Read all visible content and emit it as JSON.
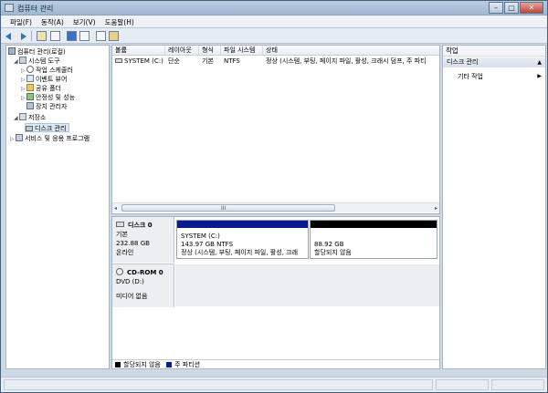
{
  "window": {
    "title": "컴퓨터 관리"
  },
  "window_buttons": {
    "minimize": "–",
    "maximize": "□",
    "close": "✕"
  },
  "menu": [
    "파일(F)",
    "동작(A)",
    "보기(V)",
    "도움말(H)"
  ],
  "tree": [
    {
      "label": "컴퓨터 관리(로컬)",
      "icon": "computer-icon",
      "indent": 0,
      "twisty": ""
    },
    {
      "label": "시스템 도구",
      "icon": "tools-icon",
      "indent": 1,
      "twisty": "◢"
    },
    {
      "label": "작업 스케줄러",
      "icon": "clock-icon",
      "indent": 2,
      "twisty": "▷"
    },
    {
      "label": "이벤트 뷰어",
      "icon": "event-viewer-icon",
      "indent": 2,
      "twisty": "▷"
    },
    {
      "label": "공유 폴더",
      "icon": "shared-folder-icon",
      "indent": 2,
      "twisty": "▷"
    },
    {
      "label": "안정성 및 성능",
      "icon": "performance-icon",
      "indent": 2,
      "twisty": "▷"
    },
    {
      "label": "장치 관리자",
      "icon": "device-manager-icon",
      "indent": 2,
      "twisty": ""
    },
    {
      "label": "저장소",
      "icon": "storage-icon",
      "indent": 1,
      "twisty": "◢"
    },
    {
      "label": "디스크 관리",
      "icon": "disk-management-icon",
      "indent": 2,
      "twisty": "",
      "selected": true
    },
    {
      "label": "서비스 및 응용 프로그램",
      "icon": "services-icon",
      "indent": 1,
      "twisty": "▷"
    }
  ],
  "volume_list": {
    "columns": [
      "볼륨",
      "레이아웃",
      "형식",
      "파일 시스템",
      "상태"
    ],
    "rows": [
      [
        "SYSTEM (C:)",
        "단순",
        "기본",
        "NTFS",
        "정상 (시스템, 부팅, 페이지 파일, 활성, 크래시 덤프, 주 파티"
      ]
    ],
    "scroll_grip": "III",
    "scroll_left": "◂",
    "scroll_right": "▸"
  },
  "disks": [
    {
      "name": "디스크 0",
      "type": "기본",
      "size": "232.88 GB",
      "status": "온라인",
      "partitions": [
        {
          "name": "SYSTEM (C:)",
          "detail": "143.97 GB NTFS",
          "status": "정상 (시스템, 부팅, 페이지 파일, 활성, 크래",
          "kind": "primary"
        },
        {
          "name": "",
          "detail": "88.92 GB",
          "status": "할당되지 않음",
          "kind": "unallocated"
        }
      ]
    },
    {
      "name": "CD-ROM 0",
      "type": "DVD (D:)",
      "size": "",
      "status": "미디어 없음"
    }
  ],
  "legend": [
    {
      "label": "할당되지 않음",
      "color": "#000000"
    },
    {
      "label": "주 파티션",
      "color": "#0c1a8a"
    }
  ],
  "actions": {
    "title": "작업",
    "section": "디스크 관리",
    "section_arrow": "▲",
    "item": "기타 작업",
    "item_arrow": "▶"
  },
  "colors": {
    "primary_partition": "#0c1a8a",
    "unallocated": "#000000",
    "selection": "#dce8f5"
  }
}
